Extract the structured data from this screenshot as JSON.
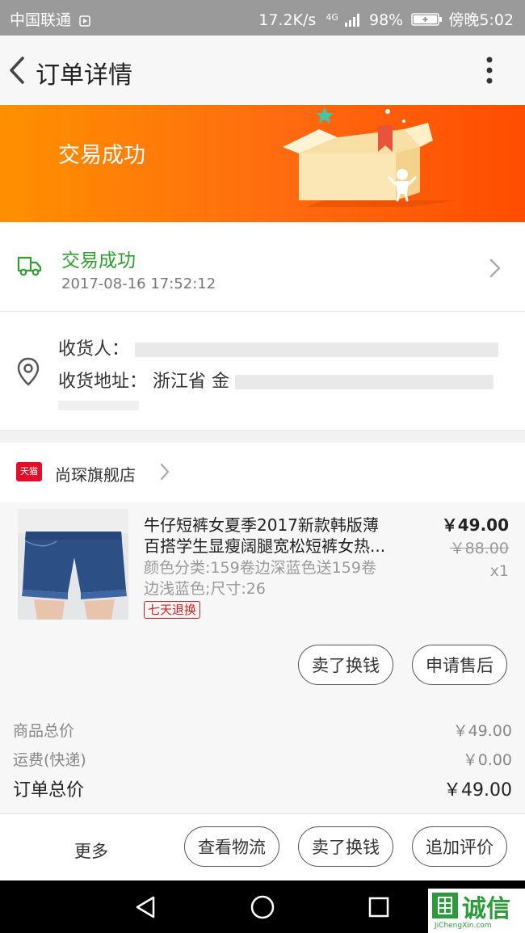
{
  "status_bar": {
    "carrier": "中国联通",
    "speed": "17.2K/s",
    "network": "4G",
    "battery": "98%",
    "time": "傍晚5:02"
  },
  "navbar": {
    "title": "订单详情",
    "back_icon": "chevron-left-icon",
    "more_icon": "vertical-dots-icon"
  },
  "banner": {
    "text": "交易成功"
  },
  "logistics": {
    "status": "交易成功",
    "time": "2017-08-16 17:52:12"
  },
  "address": {
    "receiver_label": "收货人：",
    "address_label": "收货地址：",
    "address_value": "浙江省 金"
  },
  "shop": {
    "badge": "天猫",
    "name": "尚琛旗舰店"
  },
  "product": {
    "title_line1": "牛仔短裤女夏季2017新款韩版薄",
    "title_line2": "百搭学生显瘦阔腿宽松短裤女热...",
    "spec_line1": "颜色分类:159卷边深蓝色送159卷",
    "spec_line2": "边浅蓝色;尺寸:26",
    "tag": "七天退换",
    "price": "￥49.00",
    "original_price": "￥88.00",
    "quantity": "x1",
    "buttons": [
      "卖了换钱",
      "申请售后"
    ]
  },
  "summary": {
    "goods_label": "商品总价",
    "goods_value": "￥49.00",
    "shipping_label": "运费(快递)",
    "shipping_value": "￥0.00",
    "total_label": "订单总价",
    "total_value": "￥49.00"
  },
  "bottom_bar": {
    "more": "更多",
    "buttons": [
      "查看物流",
      "卖了换钱",
      "追加评价"
    ]
  },
  "watermark": {
    "text": "诚信",
    "sub": "JiChengXin.com"
  },
  "colors": {
    "accent_orange": "#ff6a10",
    "success_green": "#2f9e2f",
    "tag_red": "#d81e1e",
    "tmall_red": "#e0102b"
  }
}
